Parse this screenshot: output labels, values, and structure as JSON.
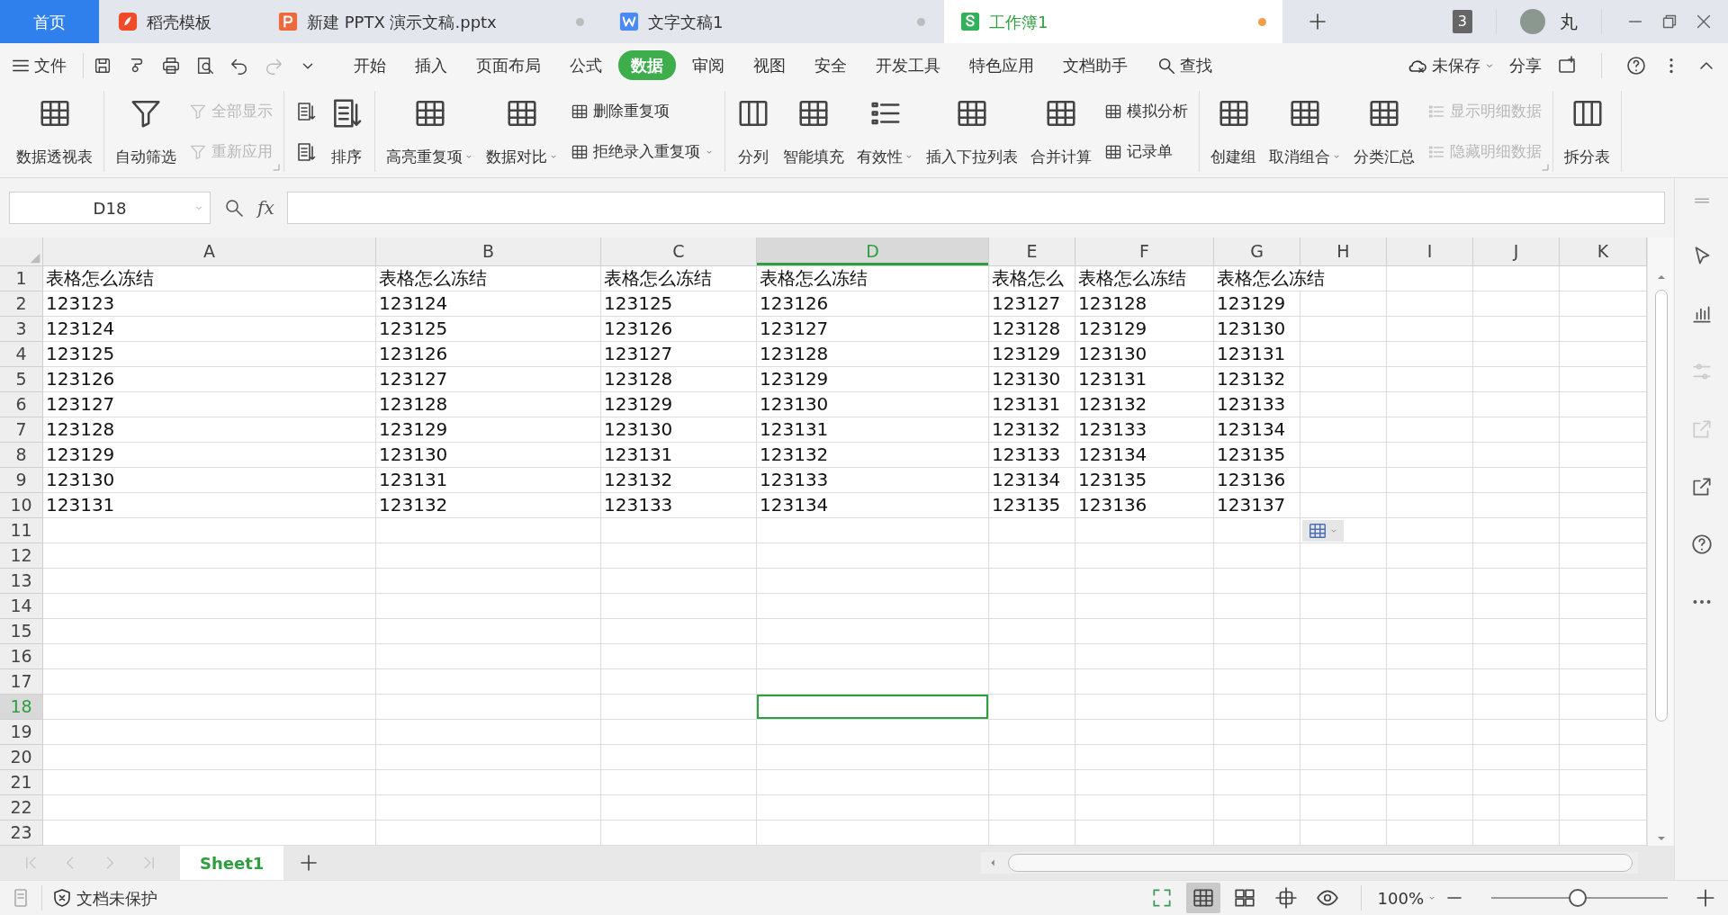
{
  "tabs": [
    {
      "kind": "home",
      "label": "首页",
      "selected": false
    },
    {
      "kind": "docer",
      "label": "稻壳模板",
      "selected": false
    },
    {
      "kind": "pptx",
      "label": "新建 PPTX 演示文稿.pptx",
      "selected": false,
      "color": "#bdbdbd"
    },
    {
      "kind": "docx",
      "label": "文字文稿1",
      "selected": false,
      "color": "#bdbdbd"
    },
    {
      "kind": "xlsx",
      "label": "工作簿1",
      "selected": true,
      "color": "#f0a04b"
    }
  ],
  "account": {
    "badge": "3",
    "name": "丸"
  },
  "menu": {
    "file": "文件",
    "tabs": [
      {
        "label": "开始",
        "selected": false
      },
      {
        "label": "插入",
        "selected": false
      },
      {
        "label": "页面布局",
        "selected": false
      },
      {
        "label": "公式",
        "selected": false
      },
      {
        "label": "数据",
        "selected": true
      },
      {
        "label": "审阅",
        "selected": false
      },
      {
        "label": "视图",
        "selected": false
      },
      {
        "label": "安全",
        "selected": false
      },
      {
        "label": "开发工具",
        "selected": false
      },
      {
        "label": "特色应用",
        "selected": false
      },
      {
        "label": "文档助手",
        "selected": false
      }
    ],
    "search": "查找",
    "save_status": "未保存",
    "share": "分享"
  },
  "ribbon": [
    {
      "items": [
        {
          "kind": "large",
          "label": "数据透视表"
        }
      ]
    },
    {
      "launcher": true,
      "items": [
        {
          "kind": "large",
          "label": "自动筛选"
        },
        {
          "kind": "stack",
          "buttons": [
            {
              "label": "全部显示",
              "disabled": true
            },
            {
              "label": "重新应用",
              "disabled": true
            }
          ]
        }
      ]
    },
    {
      "items": [
        {
          "kind": "stack",
          "buttons": [
            {
              "disabled": false
            },
            {
              "disabled": false
            }
          ]
        },
        {
          "kind": "large",
          "label": "排序"
        }
      ]
    },
    {
      "items": [
        {
          "kind": "large",
          "label": "高亮重复项",
          "dropdown": true
        },
        {
          "kind": "large",
          "label": "数据对比",
          "dropdown": true
        },
        {
          "kind": "stack",
          "buttons": [
            {
              "label": "删除重复项",
              "disabled": false
            },
            {
              "label": "拒绝录入重复项",
              "disabled": false,
              "dropdown": true
            }
          ]
        }
      ]
    },
    {
      "items": [
        {
          "kind": "large",
          "label": "分列"
        },
        {
          "kind": "large",
          "label": "智能填充"
        },
        {
          "kind": "large",
          "label": "有效性",
          "dropdown": true
        },
        {
          "kind": "large",
          "label": "插入下拉列表"
        },
        {
          "kind": "large",
          "label": "合并计算"
        },
        {
          "kind": "stack",
          "buttons": [
            {
              "label": "模拟分析",
              "disabled": false
            },
            {
              "label": "记录单",
              "disabled": false
            }
          ]
        }
      ]
    },
    {
      "launcher": true,
      "items": [
        {
          "kind": "large",
          "label": "创建组"
        },
        {
          "kind": "large",
          "label": "取消组合",
          "dropdown": true
        },
        {
          "kind": "large",
          "label": "分类汇总"
        },
        {
          "kind": "stack",
          "buttons": [
            {
              "label": "显示明细数据",
              "disabled": true
            },
            {
              "label": "隐藏明细数据",
              "disabled": true
            }
          ]
        }
      ]
    },
    {
      "items": [
        {
          "kind": "large",
          "label": "拆分表"
        }
      ]
    }
  ],
  "formula_bar": {
    "name_box": "D18",
    "fx": "fx"
  },
  "sheet": {
    "columns": [
      {
        "label": "A",
        "selected": false
      },
      {
        "label": "B",
        "selected": false
      },
      {
        "label": "C",
        "selected": false
      },
      {
        "label": "D",
        "selected": true
      },
      {
        "label": "E",
        "selected": false
      },
      {
        "label": "F",
        "selected": false
      },
      {
        "label": "G",
        "selected": false
      },
      {
        "label": "H",
        "selected": false
      },
      {
        "label": "I",
        "selected": false
      },
      {
        "label": "J",
        "selected": false
      },
      {
        "label": "K",
        "selected": false
      }
    ],
    "rows": [
      {
        "label": "1",
        "selected": false,
        "cells": [
          "表格怎么冻结",
          "表格怎么冻结",
          "表格怎么冻结",
          "表格怎么冻结",
          "表格怎么",
          "表格怎么冻结",
          "表格怎么冻结"
        ]
      },
      {
        "label": "2",
        "selected": false,
        "cells": [
          "123123",
          "123124",
          "123125",
          "123126",
          "123127",
          "123128",
          "123129"
        ]
      },
      {
        "label": "3",
        "selected": false,
        "cells": [
          "123124",
          "123125",
          "123126",
          "123127",
          "123128",
          "123129",
          "123130"
        ]
      },
      {
        "label": "4",
        "selected": false,
        "cells": [
          "123125",
          "123126",
          "123127",
          "123128",
          "123129",
          "123130",
          "123131"
        ]
      },
      {
        "label": "5",
        "selected": false,
        "cells": [
          "123126",
          "123127",
          "123128",
          "123129",
          "123130",
          "123131",
          "123132"
        ]
      },
      {
        "label": "6",
        "selected": false,
        "cells": [
          "123127",
          "123128",
          "123129",
          "123130",
          "123131",
          "123132",
          "123133"
        ]
      },
      {
        "label": "7",
        "selected": false,
        "cells": [
          "123128",
          "123129",
          "123130",
          "123131",
          "123132",
          "123133",
          "123134"
        ]
      },
      {
        "label": "8",
        "selected": false,
        "cells": [
          "123129",
          "123130",
          "123131",
          "123132",
          "123133",
          "123134",
          "123135"
        ]
      },
      {
        "label": "9",
        "selected": false,
        "cells": [
          "123130",
          "123131",
          "123132",
          "123133",
          "123134",
          "123135",
          "123136"
        ]
      },
      {
        "label": "10",
        "selected": false,
        "cells": [
          "123131",
          "123132",
          "123133",
          "123134",
          "123135",
          "123136",
          "123137"
        ]
      },
      {
        "label": "11",
        "selected": false
      },
      {
        "label": "12",
        "selected": false
      },
      {
        "label": "13",
        "selected": false
      },
      {
        "label": "14",
        "selected": false
      },
      {
        "label": "15",
        "selected": false
      },
      {
        "label": "16",
        "selected": false
      },
      {
        "label": "17",
        "selected": false
      },
      {
        "label": "18",
        "selected": true
      },
      {
        "label": "19",
        "selected": false
      },
      {
        "label": "20",
        "selected": false
      },
      {
        "label": "21",
        "selected": false
      },
      {
        "label": "22",
        "selected": false
      },
      {
        "label": "23",
        "selected": false
      }
    ]
  },
  "sheet_tabs": [
    {
      "label": "Sheet1",
      "selected": true
    }
  ],
  "status_bar": {
    "protection": "文档未保护",
    "view_buttons": [
      {
        "selected": false
      },
      {
        "selected": true
      },
      {
        "selected": false
      },
      {
        "selected": false
      },
      {
        "selected": false
      }
    ],
    "zoom": "100%",
    "zoom_slider": {
      "level": 0.49
    }
  }
}
